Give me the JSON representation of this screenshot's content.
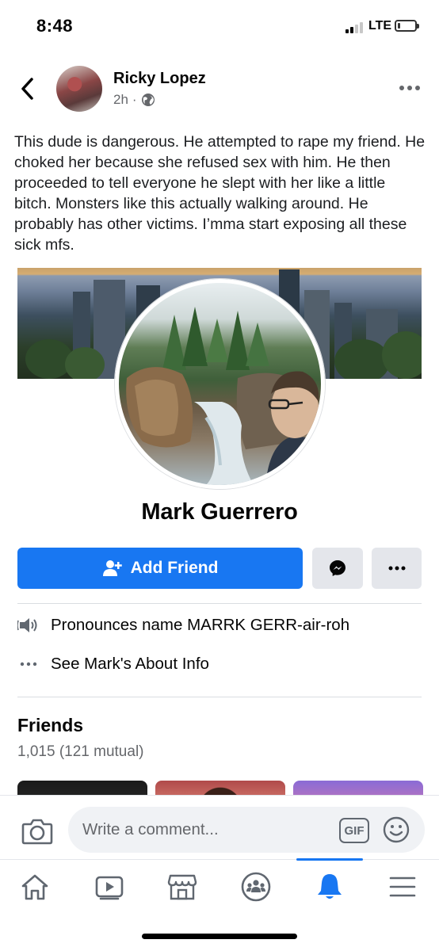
{
  "status_bar": {
    "time": "8:48",
    "network": "LTE",
    "signal_bars_filled": 2,
    "signal_bars_total": 4,
    "battery_level": 0.1
  },
  "post": {
    "author": "Ricky Lopez",
    "time": "2h",
    "separator": "·",
    "privacy_icon": "globe-icon",
    "text": "This dude is dangerous. He attempted to rape my friend. He choked her because she refused sex with him. He then proceeded to tell everyone he slept with her like a little bitch. Monsters like this actually walking around. He probably has other victims. I’mma start exposing all these sick mfs."
  },
  "shared_profile": {
    "name": "Mark Guerrero",
    "add_friend_label": "Add Friend",
    "pronunciation_label": "Pronounces name MARRK GERR-air-roh",
    "about_label": "See Mark's About Info",
    "friends_title": "Friends",
    "friends_count": "1,015 (121 mutual)"
  },
  "comment_bar": {
    "placeholder": "Write a comment...",
    "gif_label": "GIF"
  },
  "nav": {
    "items": [
      "home-icon",
      "watch-icon",
      "marketplace-icon",
      "groups-icon",
      "notifications-icon",
      "menu-icon"
    ],
    "active": "notifications-icon"
  },
  "colors": {
    "accent": "#1877f2",
    "secondary_button": "#e4e6eb",
    "muted_text": "#65676b",
    "input_bg": "#f0f2f5"
  }
}
